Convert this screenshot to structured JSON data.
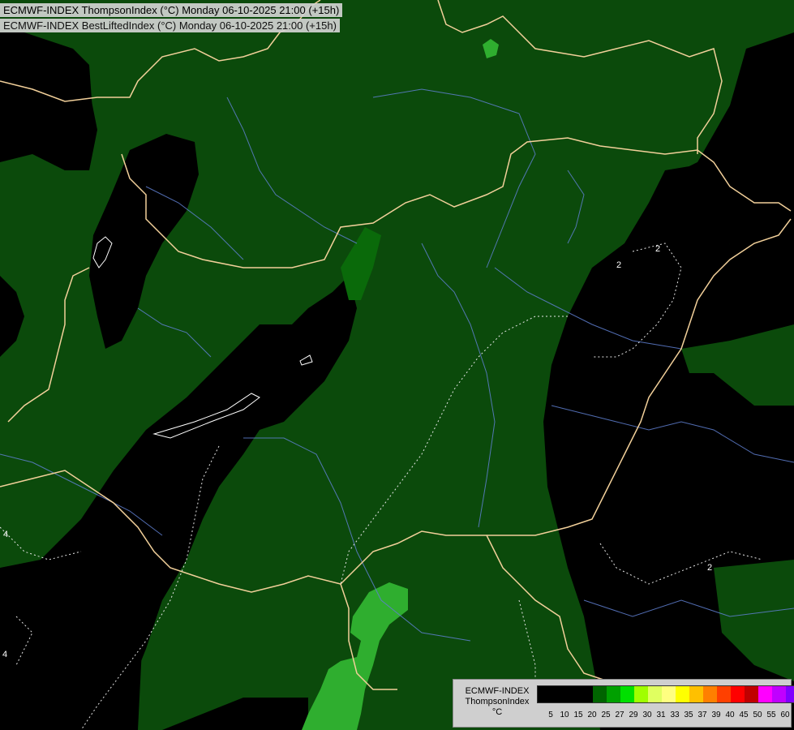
{
  "titles": {
    "line1": "ECMWF-INDEX ThompsonIndex (°C) Monday 06-10-2025 21:00 (+15h)",
    "line2": "ECMWF-INDEX BestLiftedIndex (°C) Monday 06-10-2025 21:00 (+15h)"
  },
  "legend": {
    "title_line1": "ECMWF-INDEX",
    "title_line2": "ThompsonIndex",
    "unit": "°C",
    "tick_labels": [
      "5",
      "10",
      "15",
      "20",
      "25",
      "27",
      "29",
      "30",
      "31",
      "33",
      "35",
      "37",
      "39",
      "40",
      "45",
      "50",
      "55",
      "60"
    ],
    "colors": [
      "#000000",
      "#000000",
      "#000000",
      "#000000",
      "#006400",
      "#00a000",
      "#00e000",
      "#a0ff00",
      "#e0ff60",
      "#ffff80",
      "#ffff00",
      "#ffc000",
      "#ff8000",
      "#ff4000",
      "#ff0000",
      "#c00000",
      "#ff00ff",
      "#c000ff",
      "#8000ff",
      "#4040ff",
      "#0000ff"
    ]
  },
  "contour_labels": [
    "2",
    "2",
    "2",
    "4",
    "4"
  ],
  "map_colors": {
    "background": "#000000",
    "field_dark_green": "#0b4a0b",
    "field_mid_green": "#0a6a0a",
    "field_light_green": "#2fae2f",
    "borders": "#f2d09a",
    "rivers": "#5f7fd0",
    "isolines": "#e6e6e6"
  }
}
